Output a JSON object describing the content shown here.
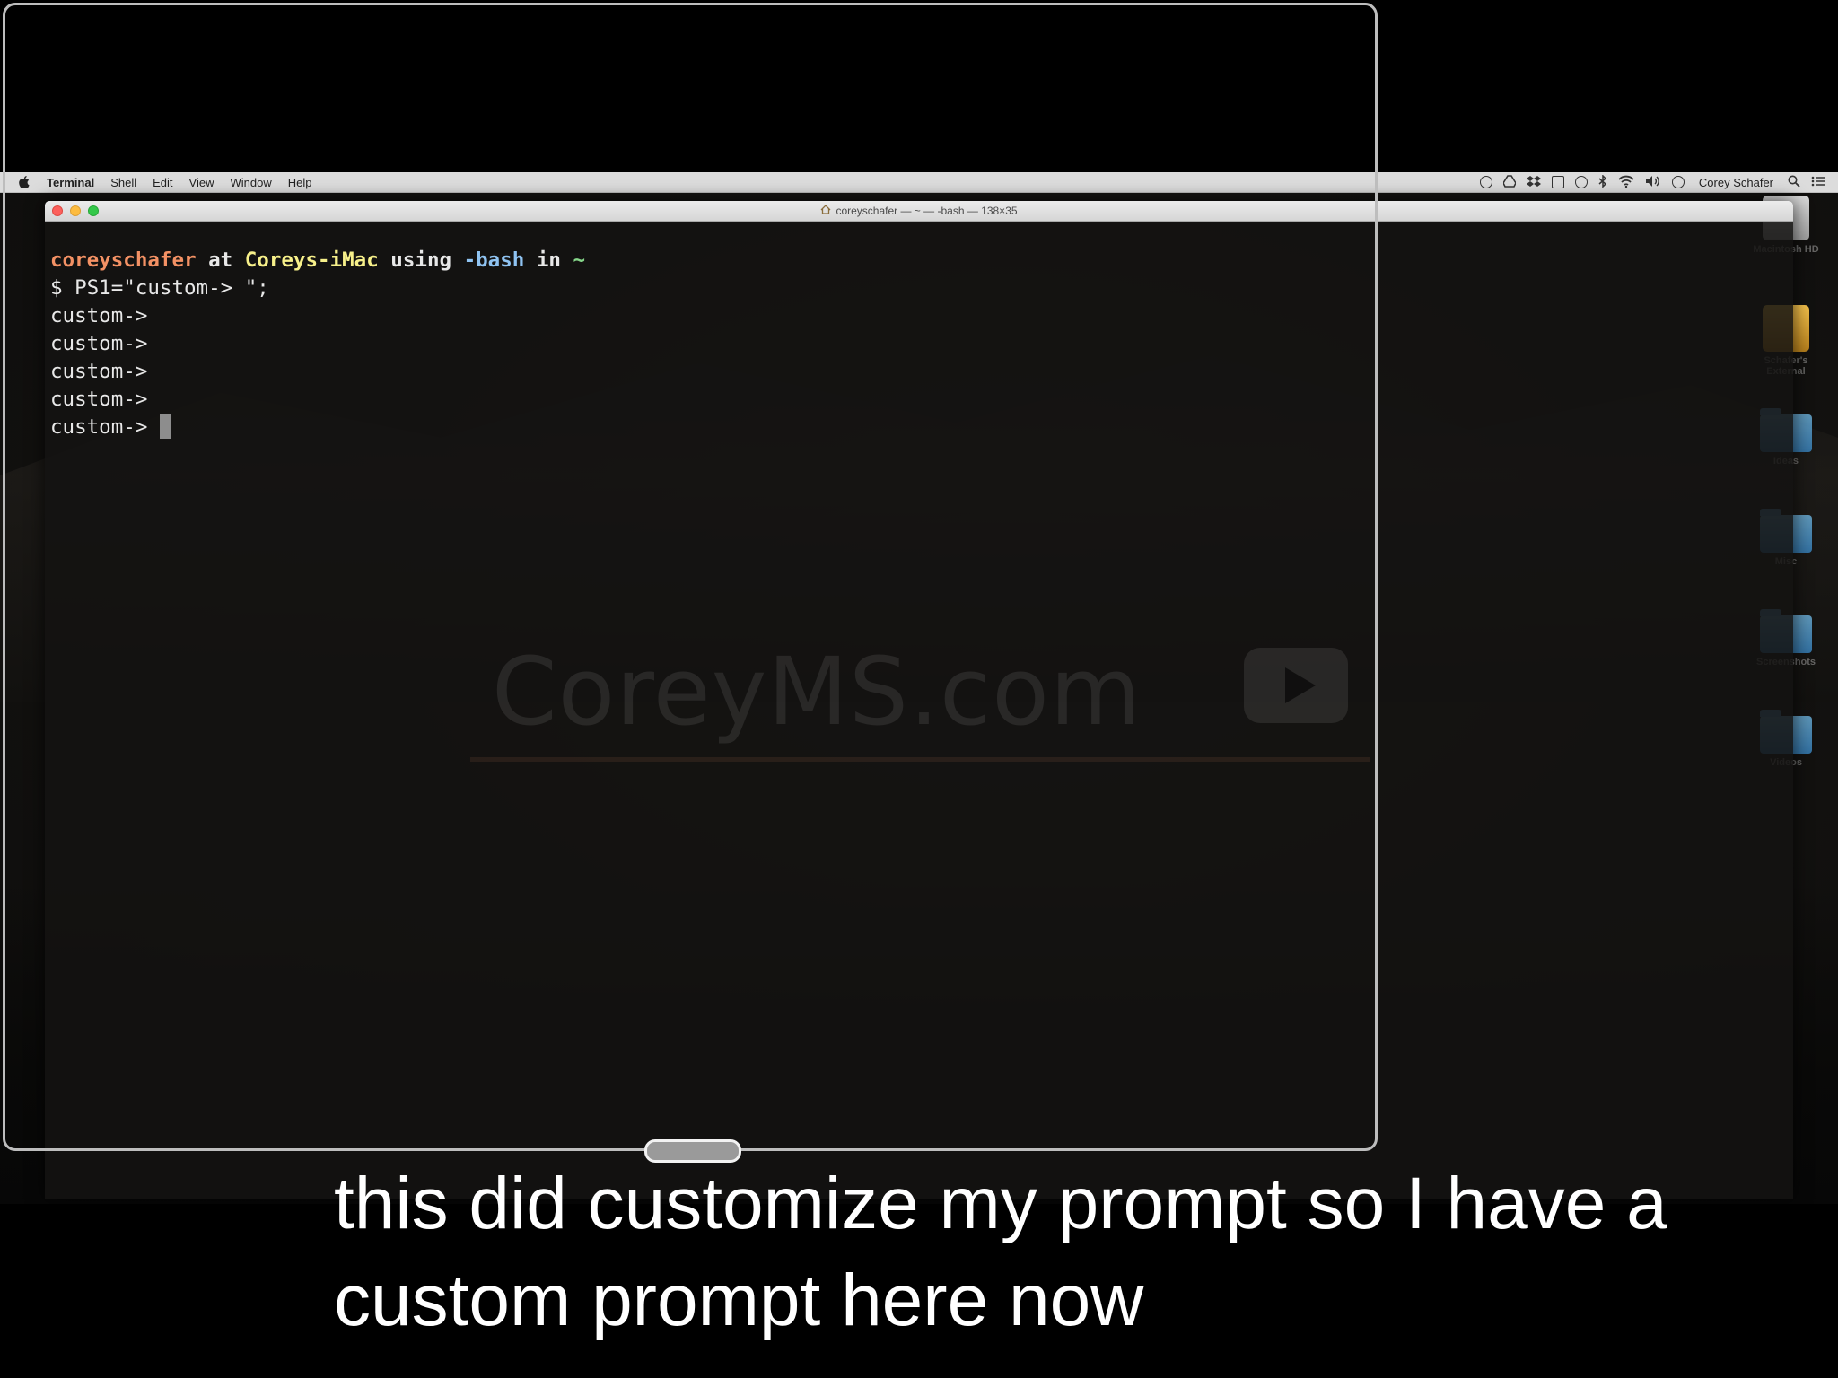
{
  "menubar": {
    "app_name": "Terminal",
    "items": [
      "Shell",
      "Edit",
      "View",
      "Window",
      "Help"
    ],
    "user_name": "Corey Schafer",
    "status_icons": [
      "record-icon",
      "google-drive-icon",
      "dropbox-icon",
      "airplay-icon",
      "time-machine-icon",
      "bluetooth-icon",
      "wifi-icon",
      "volume-icon",
      "clock-icon"
    ]
  },
  "window": {
    "title": "coreyschafer — ~ — -bash — 138×35"
  },
  "terminal": {
    "prompt_user": "coreyschafer",
    "prompt_at": " at ",
    "prompt_host": "Coreys-iMac",
    "prompt_using": " using ",
    "prompt_shell": "-bash",
    "prompt_in": " in ",
    "prompt_dir": "~",
    "command_line": "$ PS1=\"custom-> \";",
    "custom_prompts": [
      "custom->",
      "custom->",
      "custom->",
      "custom->"
    ],
    "active_prompt": "custom->"
  },
  "watermark": {
    "text": "CoreyMS.com",
    "icon": "play-button-icon"
  },
  "desktop_icons": [
    {
      "label": "Macintosh HD",
      "icon": "hard-drive-icon"
    },
    {
      "label": "Schafer's External",
      "icon": "external-drive-icon"
    },
    {
      "label": "Ideas",
      "icon": "folder-icon"
    },
    {
      "label": "Misc",
      "icon": "folder-icon"
    },
    {
      "label": "Screenshots",
      "icon": "folder-icon"
    },
    {
      "label": "Videos",
      "icon": "folder-icon"
    }
  ],
  "caption": {
    "line1": "this did customize my prompt so I have a",
    "line2": "custom prompt here now"
  },
  "colors": {
    "user": "#f39164",
    "host": "#f7f08a",
    "shell": "#8fc3f2",
    "dir": "#86d68a",
    "caption": "#ffffff"
  }
}
